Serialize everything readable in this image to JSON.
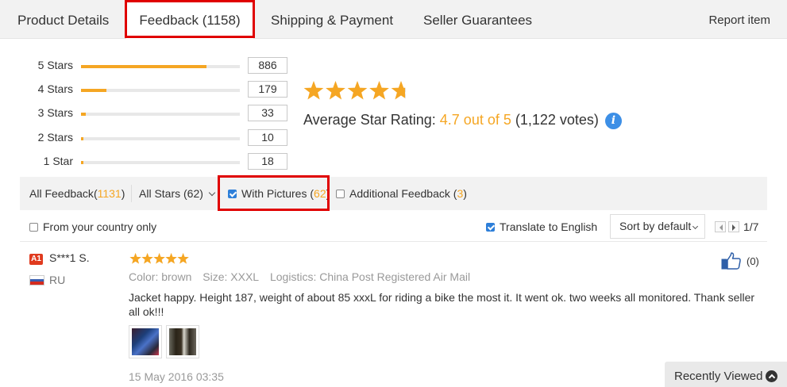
{
  "tabs": {
    "product_details": "Product Details",
    "feedback": "Feedback (1158)",
    "shipping": "Shipping & Payment",
    "guarantees": "Seller Guarantees",
    "report": "Report item"
  },
  "histogram": [
    {
      "label": "5 Stars",
      "count": "886",
      "fraction": 0.79
    },
    {
      "label": "4 Stars",
      "count": "179",
      "fraction": 0.16
    },
    {
      "label": "3 Stars",
      "count": "33",
      "fraction": 0.03
    },
    {
      "label": "2 Stars",
      "count": "10",
      "fraction": 0.01
    },
    {
      "label": "1 Star",
      "count": "18",
      "fraction": 0.016
    }
  ],
  "rating": {
    "label": "Average Star Rating:",
    "value": "4.7 out of 5",
    "votes": "(1,122 votes)",
    "stars": 4.7,
    "info_icon": "info-icon"
  },
  "filters": {
    "all_feedback_label": "All Feedback",
    "all_feedback_open": "(",
    "all_feedback_count": "1131",
    "all_feedback_close": ")",
    "all_stars": "All Stars (62)",
    "with_pictures_label": "With Pictures",
    "with_pictures_open": "(",
    "with_pictures_count": "62",
    "with_pictures_close": ")",
    "with_pictures_checked": true,
    "additional_label": "Additional Feedback",
    "additional_open": "(",
    "additional_count": "3",
    "additional_close": ")",
    "additional_checked": false
  },
  "options": {
    "from_country": "From your country only",
    "from_country_checked": false,
    "translate": "Translate to English",
    "translate_checked": true,
    "sort": "Sort by default",
    "page": "1/7"
  },
  "review": {
    "badge": "A1",
    "user": "S***1 S.",
    "country": "RU",
    "stars": 5,
    "color": "Color: brown",
    "size": "Size: XXXL",
    "logistics": "Logistics: China Post Registered Air Mail",
    "text": "Jacket happy. Height 187, weight of about 85 xxxL for riding a bike the most it. It went ok. two weeks all monitored. Thank seller all ok!!!",
    "date": "15 May 2016 03:35",
    "helpful_count": "(0)"
  },
  "recently_viewed": "Recently Viewed",
  "colors": {
    "accent": "#f5a623",
    "highlight_box": "#e00000",
    "checkbox": "#2e7fd9"
  }
}
